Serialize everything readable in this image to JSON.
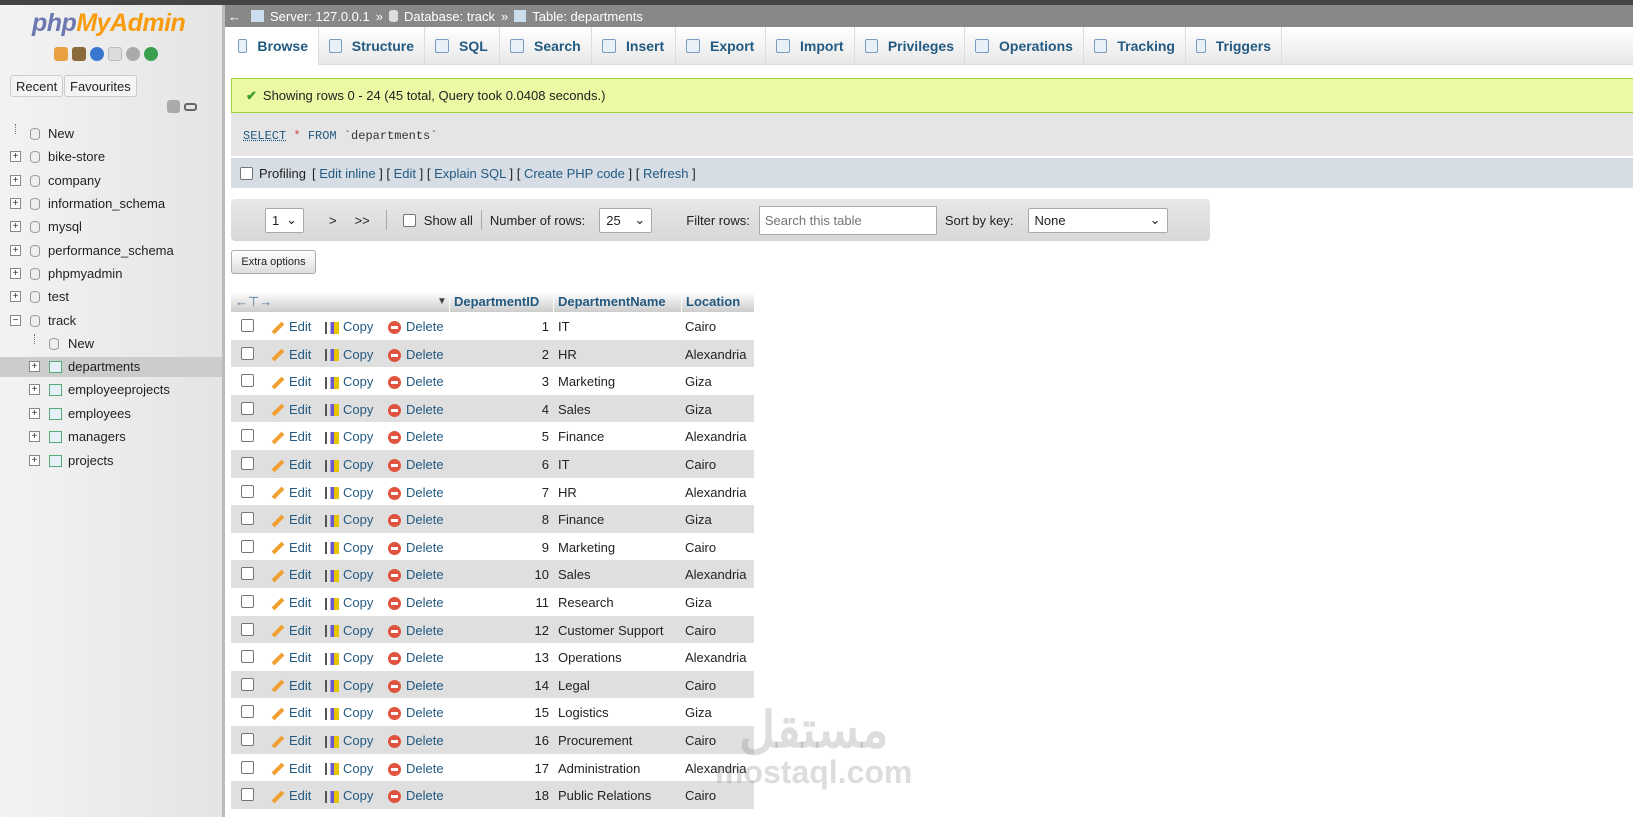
{
  "sidebar": {
    "logo": {
      "php": "php",
      "myadmin": "MyAdmin"
    },
    "buttons": {
      "recent": "Recent",
      "favourites": "Favourites"
    },
    "tree": [
      {
        "label": "New",
        "level": 0,
        "type": "new"
      },
      {
        "label": "bike-store",
        "level": 0,
        "type": "db"
      },
      {
        "label": "company",
        "level": 0,
        "type": "db"
      },
      {
        "label": "information_schema",
        "level": 0,
        "type": "db"
      },
      {
        "label": "mysql",
        "level": 0,
        "type": "db"
      },
      {
        "label": "performance_schema",
        "level": 0,
        "type": "db"
      },
      {
        "label": "phpmyadmin",
        "level": 0,
        "type": "db"
      },
      {
        "label": "test",
        "level": 0,
        "type": "db"
      },
      {
        "label": "track",
        "level": 0,
        "type": "db-open"
      },
      {
        "label": "New",
        "level": 1,
        "type": "new"
      },
      {
        "label": "departments",
        "level": 1,
        "type": "table",
        "selected": true
      },
      {
        "label": "employeeprojects",
        "level": 1,
        "type": "table"
      },
      {
        "label": "employees",
        "level": 1,
        "type": "table"
      },
      {
        "label": "managers",
        "level": 1,
        "type": "table"
      },
      {
        "label": "projects",
        "level": 1,
        "type": "table"
      }
    ]
  },
  "breadcrumb": {
    "server": "Server: 127.0.0.1",
    "database": "Database: track",
    "table": "Table: departments",
    "sep": "»",
    "back": "←"
  },
  "tabs": [
    "Browse",
    "Structure",
    "SQL",
    "Search",
    "Insert",
    "Export",
    "Import",
    "Privileges",
    "Operations",
    "Tracking",
    "Triggers"
  ],
  "success": "Showing rows 0 - 24 (45 total, Query took 0.0408 seconds.)",
  "sql": {
    "select": "SELECT",
    "star": "*",
    "from": "FROM",
    "table": "`departments`"
  },
  "profiling": {
    "label": "Profiling",
    "links": [
      "Edit inline",
      "Edit",
      "Explain SQL",
      "Create PHP code",
      "Refresh"
    ]
  },
  "nav": {
    "page": "1",
    "next": ">",
    "last": ">>",
    "show_all": "Show all",
    "rows_label": "Number of rows:",
    "rows_value": "25",
    "filter_label": "Filter rows:",
    "filter_placeholder": "Search this table",
    "sort_label": "Sort by key:",
    "sort_value": "None"
  },
  "extra_options": "Extra options",
  "table": {
    "columns": [
      "DepartmentID",
      "DepartmentName",
      "Location"
    ],
    "actions": {
      "edit": "Edit",
      "copy": "Copy",
      "delete": "Delete"
    },
    "rows": [
      [
        1,
        "IT",
        "Cairo"
      ],
      [
        2,
        "HR",
        "Alexandria"
      ],
      [
        3,
        "Marketing",
        "Giza"
      ],
      [
        4,
        "Sales",
        "Giza"
      ],
      [
        5,
        "Finance",
        "Alexandria"
      ],
      [
        6,
        "IT",
        "Cairo"
      ],
      [
        7,
        "HR",
        "Alexandria"
      ],
      [
        8,
        "Finance",
        "Giza"
      ],
      [
        9,
        "Marketing",
        "Cairo"
      ],
      [
        10,
        "Sales",
        "Alexandria"
      ],
      [
        11,
        "Research",
        "Giza"
      ],
      [
        12,
        "Customer Support",
        "Cairo"
      ],
      [
        13,
        "Operations",
        "Alexandria"
      ],
      [
        14,
        "Legal",
        "Cairo"
      ],
      [
        15,
        "Logistics",
        "Giza"
      ],
      [
        16,
        "Procurement",
        "Cairo"
      ],
      [
        17,
        "Administration",
        "Alexandria"
      ],
      [
        18,
        "Public Relations",
        "Cairo"
      ]
    ]
  },
  "watermark": {
    "arabic": "مستقل",
    "latin": "mostaql.com"
  },
  "colors": {
    "link": "#235a81",
    "success_bg": "#ebf8a4",
    "logo_blue": "#6c78af",
    "logo_orange": "#f89c0e"
  }
}
